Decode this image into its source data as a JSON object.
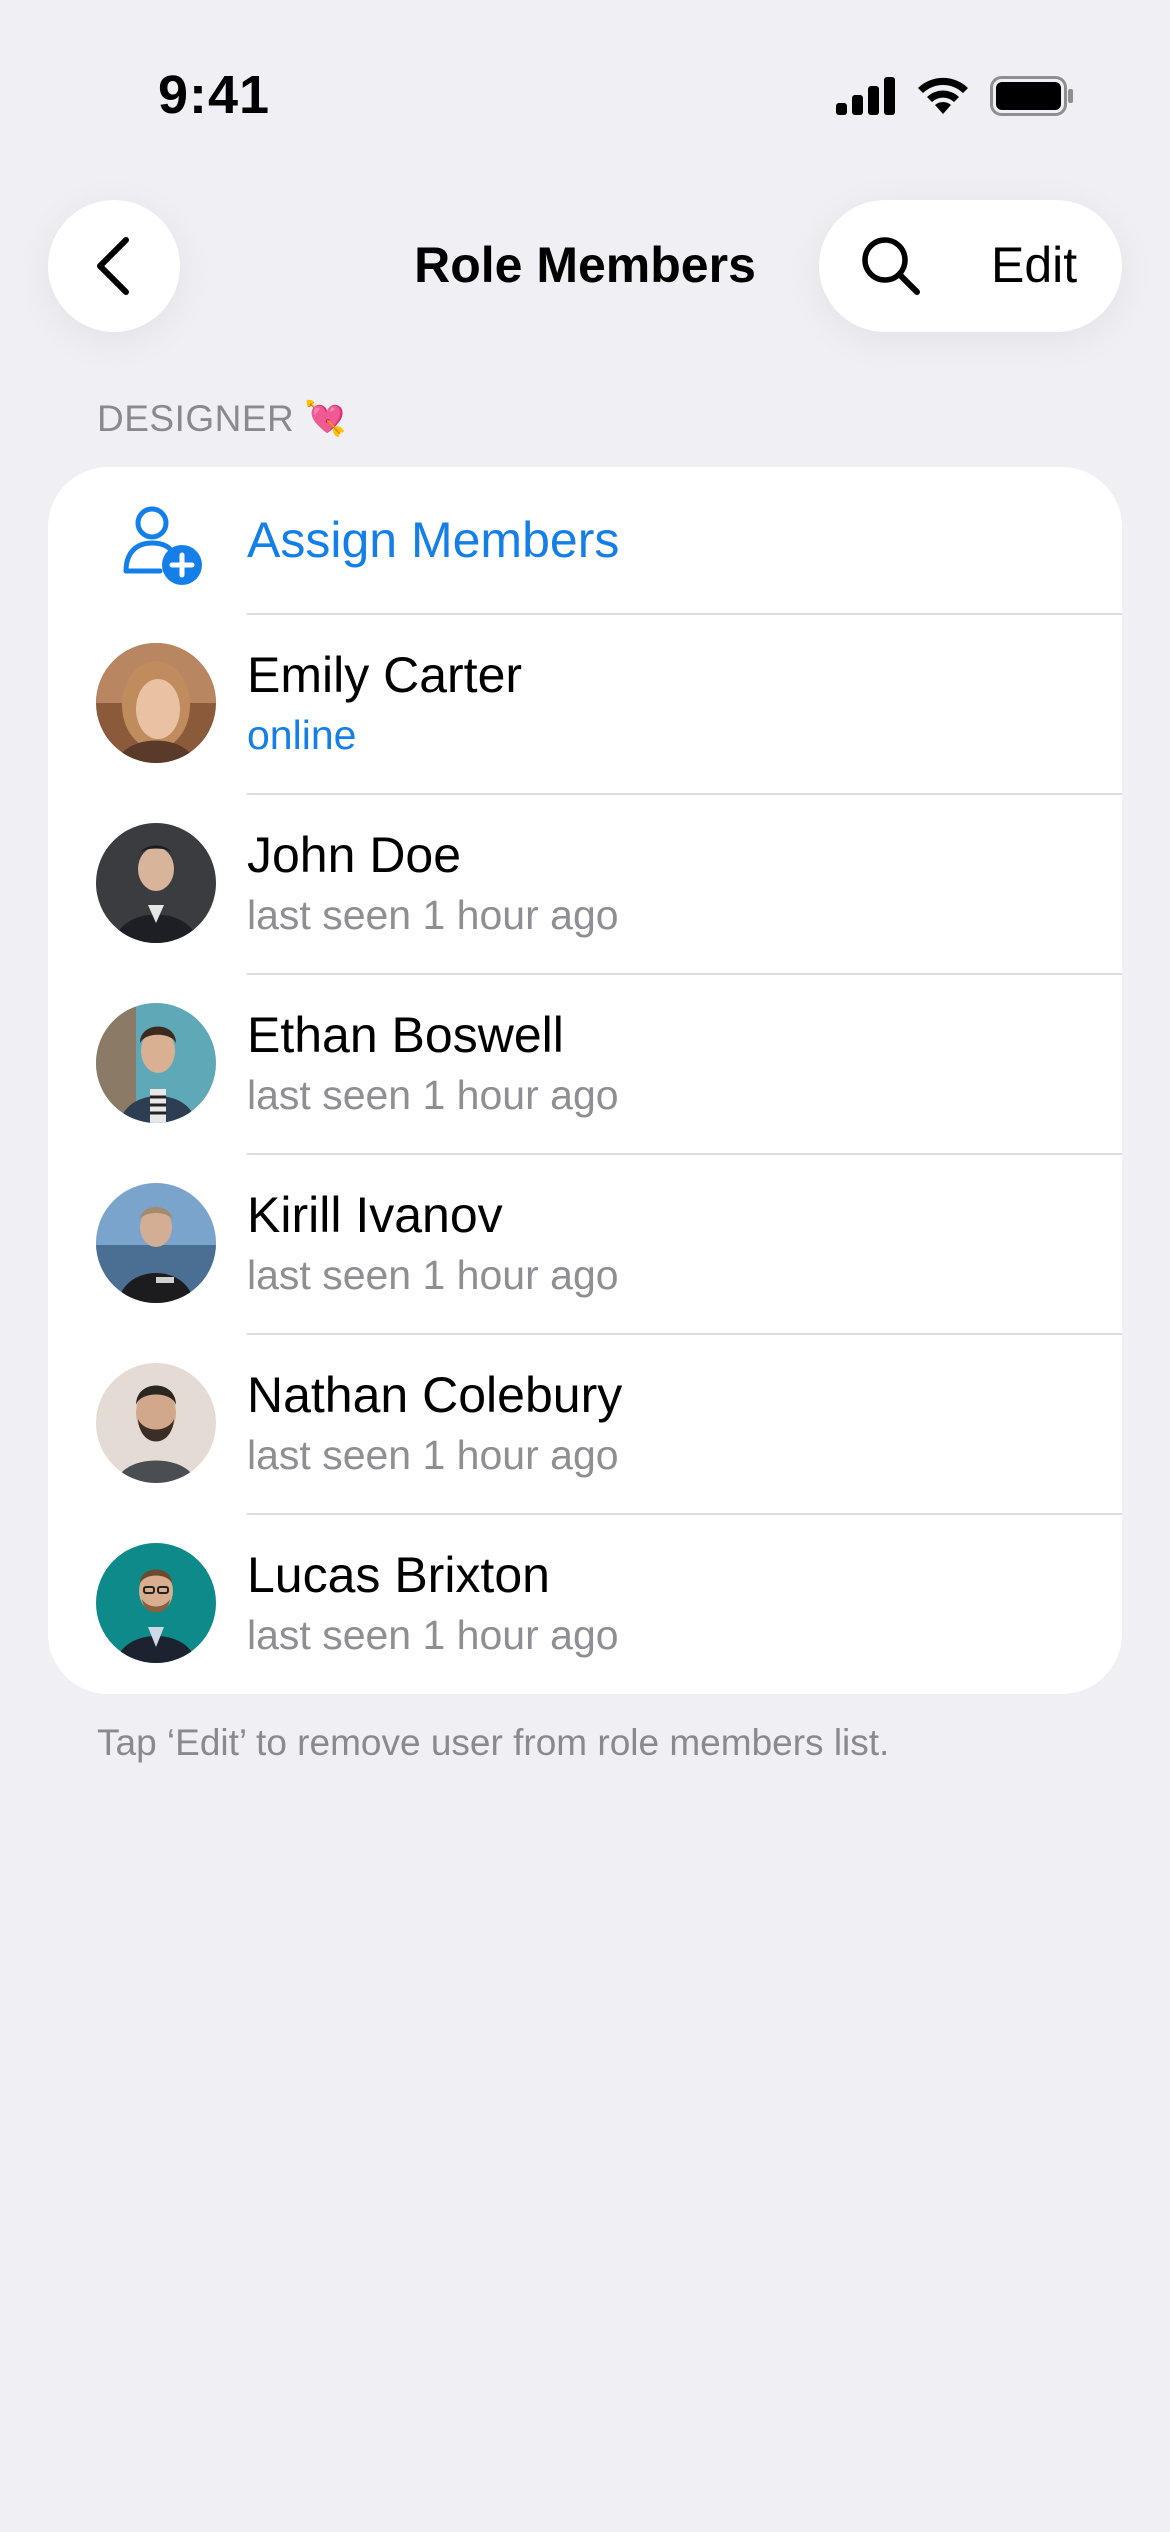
{
  "status_bar": {
    "time": "9:41"
  },
  "nav": {
    "title": "Role Members",
    "edit_label": "Edit"
  },
  "section": {
    "header": "DESIGNER",
    "header_emoji": "💘",
    "assign_label": "Assign Members",
    "footer": "Tap ‘Edit’ to remove user from role members list."
  },
  "members": [
    {
      "name": "Emily Carter",
      "status": "online",
      "online": true
    },
    {
      "name": "John Doe",
      "status": "last seen 1 hour ago",
      "online": false
    },
    {
      "name": "Ethan Boswell",
      "status": "last seen 1 hour ago",
      "online": false
    },
    {
      "name": "Kirill Ivanov",
      "status": "last seen 1 hour ago",
      "online": false
    },
    {
      "name": "Nathan Colebury",
      "status": "last seen 1 hour ago",
      "online": false
    },
    {
      "name": "Lucas Brixton",
      "status": "last seen 1 hour ago",
      "online": false
    }
  ],
  "colors": {
    "accent": "#147fe8",
    "background": "#efeff4",
    "secondary_text": "#8e8e93"
  }
}
